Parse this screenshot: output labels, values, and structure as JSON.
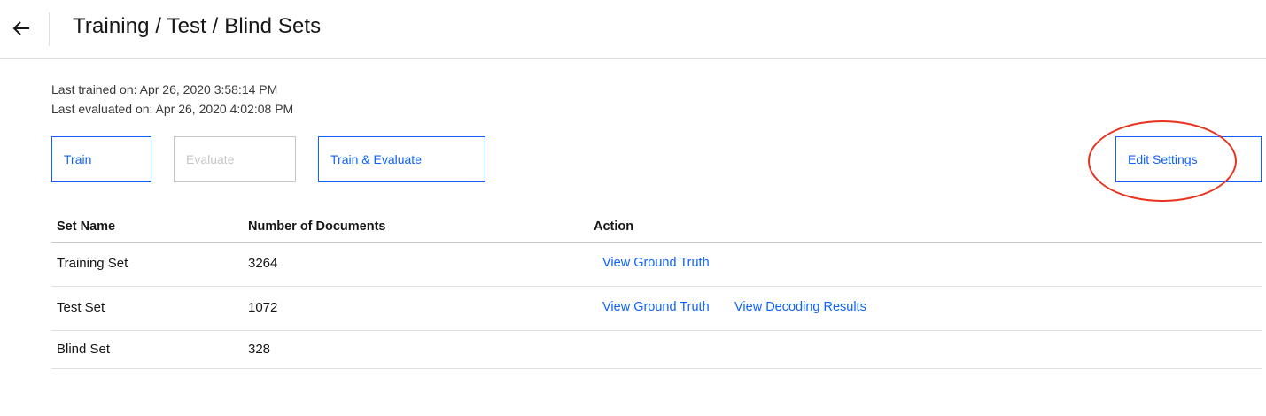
{
  "header": {
    "title": "Training / Test / Blind Sets",
    "back_icon": "arrow-left-icon"
  },
  "meta": {
    "last_trained": "Last trained on: Apr 26, 2020 3:58:14 PM",
    "last_evaluated": "Last evaluated on: Apr 26, 2020 4:02:08 PM"
  },
  "actions": {
    "train_label": "Train",
    "evaluate_label": "Evaluate",
    "train_evaluate_label": "Train & Evaluate",
    "edit_settings_label": "Edit Settings"
  },
  "table": {
    "columns": [
      "Set Name",
      "Number of Documents",
      "Action"
    ],
    "rows": [
      {
        "name": "Training Set",
        "count": "3264",
        "actions": [
          "View Ground Truth"
        ]
      },
      {
        "name": "Test Set",
        "count": "1072",
        "actions": [
          "View Ground Truth",
          "View Decoding Results"
        ]
      },
      {
        "name": "Blind Set",
        "count": "328",
        "actions": []
      }
    ]
  },
  "colors": {
    "accent": "#0f62fe",
    "disabled": "#c6c6c6",
    "annotation": "#e8321e"
  }
}
